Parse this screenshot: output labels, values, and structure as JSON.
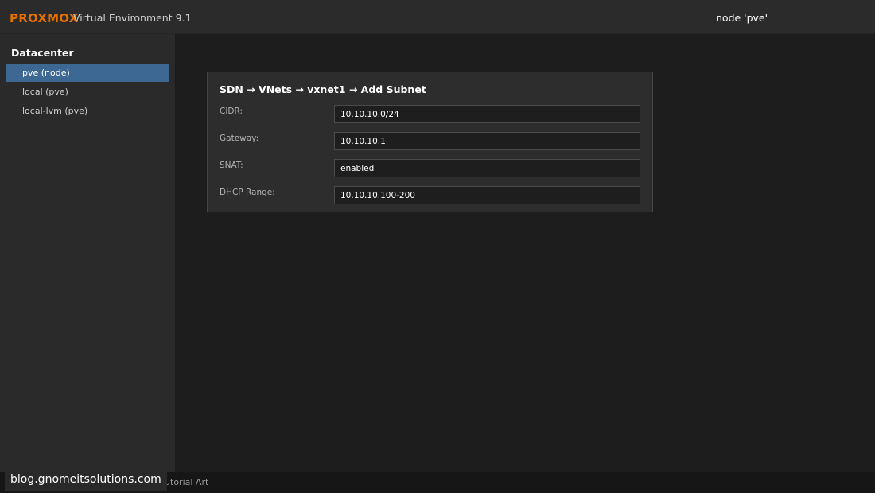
{
  "header": {
    "logo": "PROXMOX",
    "product": "Virtual Environment 9.1",
    "node": "node 'pve'"
  },
  "sidebar": {
    "heading": "Datacenter",
    "items": [
      {
        "label": "pve (node)",
        "selected": true
      },
      {
        "label": "local (pve)",
        "selected": false
      },
      {
        "label": "local-lvm (pve)",
        "selected": false
      }
    ]
  },
  "dialog": {
    "title": "SDN → VNets → vxnet1 → Add Subnet",
    "fields": [
      {
        "label": "CIDR:",
        "value": "10.10.10.0/24"
      },
      {
        "label": "Gateway:",
        "value": "10.10.10.1"
      },
      {
        "label": "SNAT:",
        "value": "enabled"
      },
      {
        "label": "DHCP Range:",
        "value": "10.10.10.100-200"
      }
    ]
  },
  "footer": {
    "text": "Tutorial Art"
  },
  "watermark": {
    "text": "blog.gnomeitsolutions.com"
  },
  "colors": {
    "brand": "#e57000",
    "selection": "#3d6894",
    "background": "#1e1e1e",
    "panel": "#2d2d2d"
  }
}
